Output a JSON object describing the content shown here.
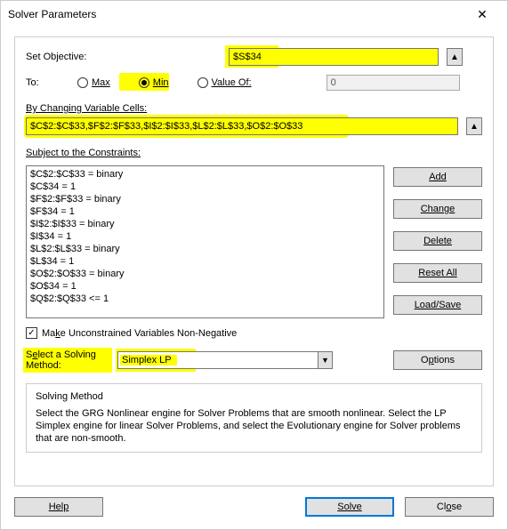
{
  "title": "Solver Parameters",
  "labels": {
    "set_objective": "Set Objective:",
    "to": "To:",
    "max": "Max",
    "min": "Min",
    "value_of": "Value Of:",
    "changing_cells": "By Changing Variable Cells:",
    "subject_to": "Subject to the Constraints:",
    "make_unconstrained": "Make Unconstrained Variables Non-Negative",
    "select_method_l1": "Select a Solving",
    "select_method_l2": "Method:",
    "solving_method_title": "Solving Method",
    "solving_method_desc": "Select the GRG Nonlinear engine for Solver Problems that are smooth nonlinear. Select the LP Simplex engine for linear Solver Problems, and select the Evolutionary engine for Solver problems that are non-smooth."
  },
  "fields": {
    "objective": "$S$34",
    "value_of": "0",
    "changing_cells": "$C$2:$C$33,$F$2:$F$33,$I$2:$I$33,$L$2:$L$33,$O$2:$O$33",
    "method": "Simplex LP"
  },
  "radio_selected": "min",
  "check_unconstrained": true,
  "constraints": [
    "$C$2:$C$33 = binary",
    "$C$34 = 1",
    "$F$2:$F$33 = binary",
    "$F$34 = 1",
    "$I$2:$I$33 = binary",
    "$I$34 = 1",
    "$L$2:$L$33 = binary",
    "$L$34 = 1",
    "$O$2:$O$33 = binary",
    "$O$34 = 1",
    "$Q$2:$Q$33 <= 1"
  ],
  "buttons": {
    "add": "Add",
    "change": "Change",
    "delete": "Delete",
    "reset_all": "Reset All",
    "load_save": "Load/Save",
    "options": "Options",
    "help": "Help",
    "solve": "Solve",
    "close": "Close"
  }
}
